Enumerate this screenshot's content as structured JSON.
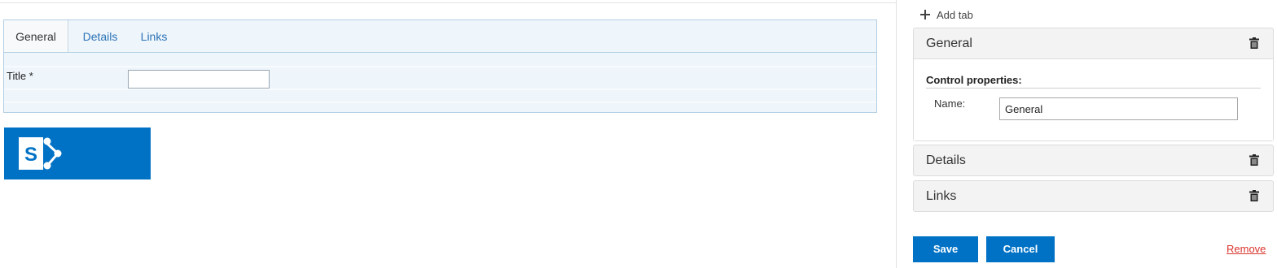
{
  "preview": {
    "tabs": [
      {
        "label": "General",
        "active": true
      },
      {
        "label": "Details",
        "active": false
      },
      {
        "label": "Links",
        "active": false
      }
    ],
    "fields": [
      {
        "label": "Title *",
        "value": ""
      }
    ]
  },
  "logo": {
    "icon": "sharepoint-logo",
    "brand_color": "#0072c6"
  },
  "editor": {
    "add_tab_label": "Add tab",
    "tabs": [
      {
        "title": "General",
        "expanded": true
      },
      {
        "title": "Details",
        "expanded": false
      },
      {
        "title": "Links",
        "expanded": false
      }
    ],
    "control_properties": {
      "heading": "Control properties:",
      "name_label": "Name:",
      "name_value": "General"
    },
    "save_label": "Save",
    "cancel_label": "Cancel",
    "remove_label": "Remove"
  },
  "colors": {
    "accent": "#0072c6",
    "remove": "#d9342b"
  }
}
